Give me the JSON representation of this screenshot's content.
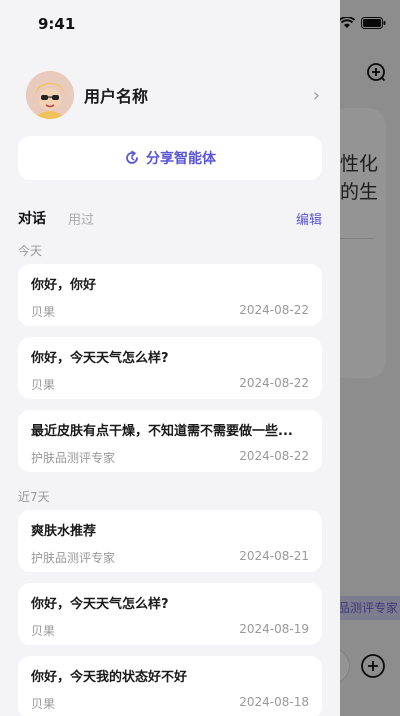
{
  "status": {
    "time": "9:41"
  },
  "drawer": {
    "user": {
      "name": "用户名称"
    },
    "share_label": "分享智能体",
    "tabs": [
      {
        "label": "对话",
        "active": true
      },
      {
        "label": "用过",
        "active": false
      }
    ],
    "edit_label": "编辑",
    "sections": [
      {
        "label": "今天",
        "items": [
          {
            "title": "你好，你好",
            "agent": "贝果",
            "date": "2024-08-22"
          },
          {
            "title": "你好，今天天气怎么样?",
            "agent": "贝果",
            "date": "2024-08-22"
          },
          {
            "title": "最近皮肤有点干燥，不知道需不需要做一些...",
            "agent": "护肤品测评专家",
            "date": "2024-08-22"
          }
        ]
      },
      {
        "label": "近7天",
        "items": [
          {
            "title": "爽肤水推荐",
            "agent": "护肤品测评专家",
            "date": "2024-08-21"
          },
          {
            "title": "你好，今天天气怎么样?",
            "agent": "贝果",
            "date": "2024-08-19"
          },
          {
            "title": "你好，今天我的状态好不好",
            "agent": "贝果",
            "date": "2024-08-18"
          }
        ]
      }
    ]
  },
  "background": {
    "card_text": [
      "性化",
      "的生"
    ],
    "tag_label": "品测评专家"
  },
  "colors": {
    "accent": "#5b56d6",
    "drawer_bg": "#f4f4f6",
    "card_bg": "#ffffff"
  }
}
